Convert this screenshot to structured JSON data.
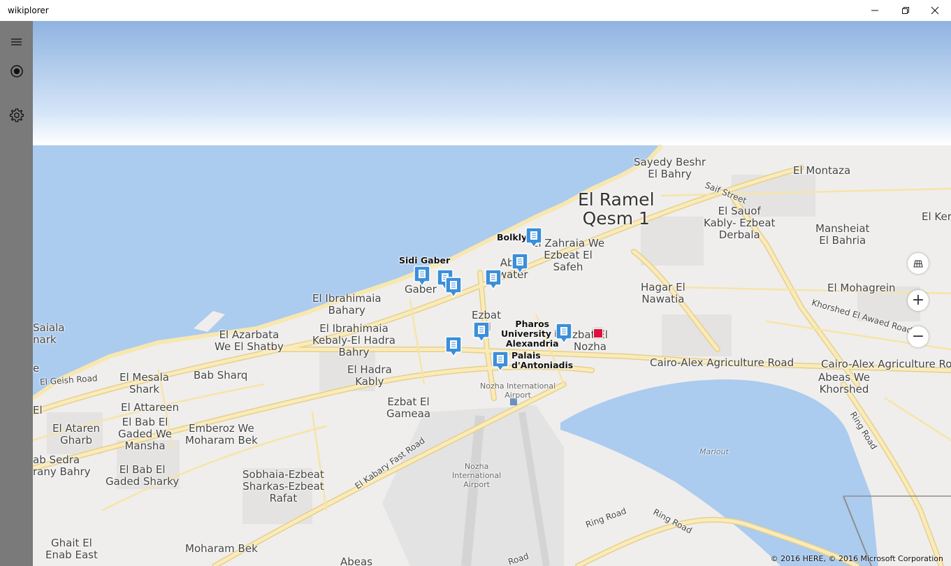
{
  "window": {
    "title": "wikiplorer",
    "minimize_icon": "minimize-icon",
    "restore_icon": "restore-icon",
    "close_icon": "close-icon"
  },
  "sidebar": {
    "menu_icon": "hamburger-menu-icon",
    "location_icon": "location-target-icon",
    "settings_icon": "gear-icon",
    "background": "#7a7a7a"
  },
  "map": {
    "colors": {
      "sky": "#9dbfe6",
      "water": "#abcbef",
      "land": "#efeeec",
      "road": "#faebb8",
      "road_edge": "#e5cf8f"
    },
    "labels": {
      "el_ramel": "El Ramel\nQesm 1",
      "sayedy_beshr": "Sayedy Beshr\nEl Bahry",
      "el_montaza": "El Montaza",
      "saif_street": "Saif Street",
      "el_sauof": "El Sauof\nKably- Ezbeat\nDerbala",
      "mansheiat": "Mansheiat\nEl Bahria",
      "el_ker": "El Ker",
      "el_zahraia": "El Zahraia We\nEzbeat El\nSafeh",
      "abo_swater": "Abo\nswater",
      "sidi_gaber_area": "Gaber",
      "hagar_el_nawatia": "Hagar El\nNawatia",
      "el_mohagrein": "El Mohagrein",
      "khorshed_road": "Khorshed El Awaed Road",
      "el_ibrahimaia_bahary": "El Ibrahimaia\nBahary",
      "el_ibrahimaia_kebaly": "El Ibrahimaia\nKebaly-El Hadra\nBahry",
      "el_azarbata": "El Azarbata\nWe El Shatby",
      "saiala": "Saiala\nnark",
      "el_geish_road": "El Geish Road",
      "el_mesala": "El Mesala\nShark",
      "bab_sharq": "Bab Sharq",
      "el_hadra_kably": "El Hadra\nKably",
      "ezbat_el_nozha": "Ezbat\nEl",
      "ezbat_el_nozha2": "zbat El\nNozha",
      "cairo_alex_1": "Cairo-Alex Agriculture Road",
      "cairo_alex_2": "Cairo-Alex Agriculture Road",
      "abeas_we_khorshed": "Abeas We\nKhorshed",
      "el_attareen": "El Attareen",
      "el_bab_el_gaded": "El Bab El\nGaded We\nMansha",
      "el_ataren_ghrb": "El Ataren\nGharb",
      "emberoz": "Emberoz We\nMoharam Bek",
      "ezbat_el_gameaa": "Ezbat El\nGameaa",
      "nozha_airport_small": "Nozha International\nAirport",
      "ring_road_right": "Ring Road",
      "mariout": "Mariout",
      "el_kabary": "El Kabary Fast Road",
      "bab_sedra": "ab Sedra\nrany Bahry",
      "el_bab_el_gaded_sharky": "El Bab El\nGaded Sharky",
      "sobhaia": "Sobhaia-Ezbeat\nSharkas-Ezbeat\nRafat",
      "nozha_airport": "Nozha\nInternational\nAirport",
      "ring_road_1": "Ring Road",
      "ring_road_2": "Ring Road",
      "ghait_el_enab": "Ghait El\nEnab East",
      "moharam_bek": "Moharam Bek",
      "abeas": "Abeas",
      "ring_road_3": "Road",
      "el_left": "El",
      "el_left2": "e"
    },
    "pois": {
      "bolkly": "Bolkly",
      "sidi_gaber": "Sidi Gaber",
      "pharos": "Pharos\nUniversity in\nAlexandria",
      "palais": "Palais\nd'Antoniadis"
    },
    "pin_icon": "wiki-article-pin-icon",
    "current_location_icon": "current-location-marker-icon",
    "controls": {
      "layers_icon": "map-style-icon",
      "zoom_in": "+",
      "zoom_out": "−"
    },
    "copyright": "© 2016 HERE, © 2016 Microsoft Corporation"
  }
}
